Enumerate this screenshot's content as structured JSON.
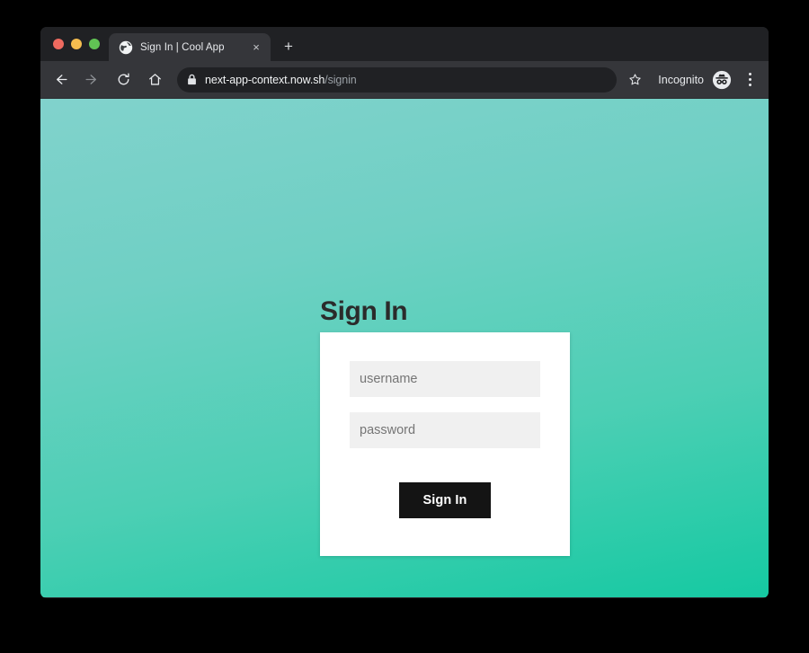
{
  "browser": {
    "traffic_lights": [
      {
        "name": "close",
        "color": "#ee6a5f"
      },
      {
        "name": "minimize",
        "color": "#f5bd4f"
      },
      {
        "name": "maximize",
        "color": "#61c454"
      }
    ],
    "tab": {
      "title": "Sign In | Cool App",
      "favicon": "globe-icon",
      "close_label": "×"
    },
    "new_tab_label": "+",
    "toolbar": {
      "back": "back-arrow-icon",
      "forward": "forward-arrow-icon",
      "reload": "reload-icon",
      "home": "home-icon",
      "lock": "lock-icon",
      "url_host": "next-app-context.now.sh",
      "url_path": "/signin",
      "bookmark": "star-icon",
      "profile_label": "Incognito",
      "profile_icon": "incognito-icon",
      "menu": "three-dot-menu-icon"
    }
  },
  "page": {
    "title": "Sign In",
    "background_top_color": "#81d2cc",
    "background_bottom_color": "#15c9a2",
    "form": {
      "username_placeholder": "username",
      "username_value": "",
      "password_placeholder": "password",
      "password_value": "",
      "submit_label": "Sign In",
      "submit_color": "#141414",
      "card_color": "#ffffff",
      "field_color": "#f0f0f0"
    }
  }
}
